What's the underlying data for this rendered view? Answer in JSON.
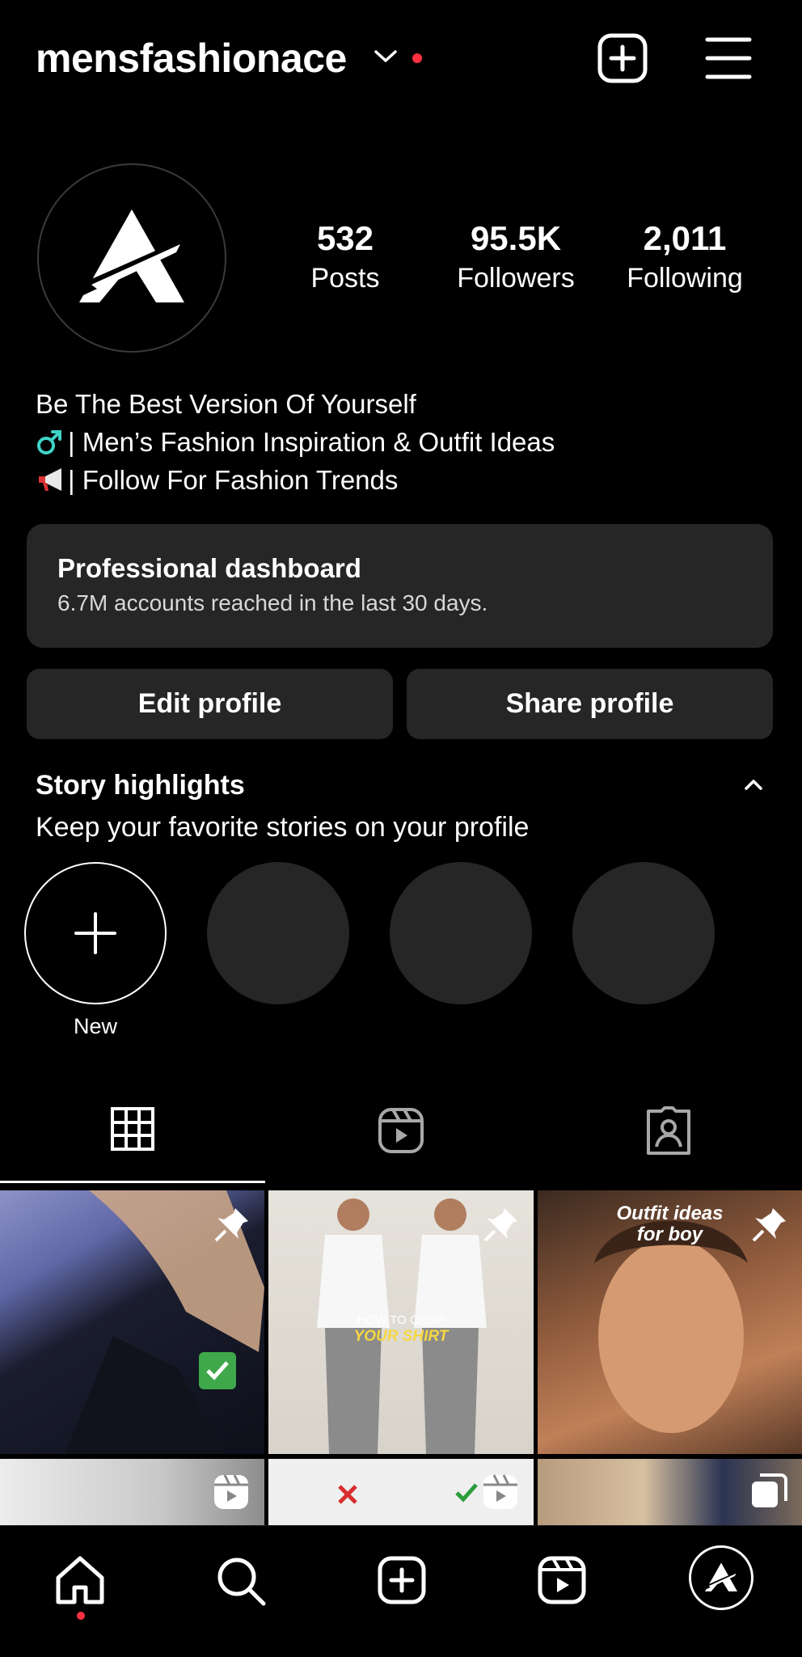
{
  "header": {
    "username": "mensfashionace"
  },
  "profile": {
    "stats": [
      {
        "value": "532",
        "label": "Posts"
      },
      {
        "value": "95.5K",
        "label": "Followers"
      },
      {
        "value": "2,011",
        "label": "Following"
      }
    ],
    "bio": [
      {
        "emoji": "male-sign",
        "text": "Be The Best Version Of Yourself"
      },
      {
        "emoji": "male-sign",
        "text": "| Men’s Fashion Inspiration & Outfit Ideas"
      },
      {
        "emoji": "megaphone",
        "text": "| Follow For Fashion Trends"
      }
    ]
  },
  "dashboard": {
    "title": "Professional dashboard",
    "subtitle": "6.7M accounts reached in the last 30 days."
  },
  "buttons": {
    "edit": "Edit profile",
    "share": "Share profile"
  },
  "highlights": {
    "title": "Story highlights",
    "subtitle": "Keep your favorite stories on your profile",
    "new_label": "New"
  },
  "posts": [
    {
      "overlay": ""
    },
    {
      "overlay_top": "HOW TO CROP",
      "overlay_bottom": "YOUR SHIRT"
    },
    {
      "overlay_top": "Outfit ideas",
      "overlay_bottom": "for boy"
    }
  ],
  "colors": {
    "background": "#000000",
    "surface": "#262626",
    "notification": "#ff3040"
  }
}
